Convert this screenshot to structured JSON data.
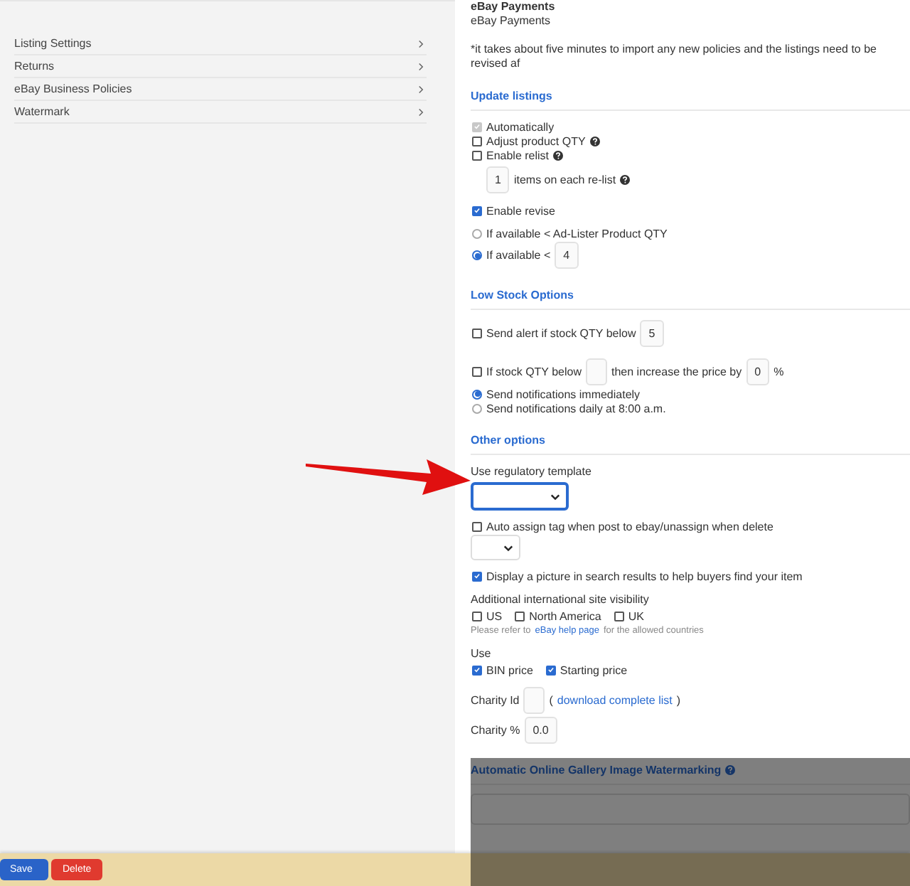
{
  "sidebar": {
    "items": [
      {
        "label": "Listing Settings"
      },
      {
        "label": "Returns"
      },
      {
        "label": "eBay Business Policies"
      },
      {
        "label": "Watermark"
      }
    ]
  },
  "payments": {
    "heading": "eBay Payments",
    "value": "eBay Payments",
    "note": "*it takes about five minutes to import any new policies and the listings need to be revised af"
  },
  "sections": [
    {
      "title": "Update listings",
      "help": false,
      "groups": [
        [
          {
            "kind": "line",
            "parts": [
              {
                "kind": "checkbox",
                "checked": true,
                "disabled": true
              },
              {
                "kind": "text",
                "text": "Automatically"
              }
            ]
          },
          {
            "kind": "line",
            "parts": [
              {
                "kind": "checkbox",
                "checked": false,
                "disabled": false
              },
              {
                "kind": "text",
                "text": "Adjust product QTY"
              },
              {
                "kind": "help"
              }
            ]
          },
          {
            "kind": "line",
            "parts": [
              {
                "kind": "checkbox",
                "checked": false,
                "disabled": false
              },
              {
                "kind": "text",
                "text": "Enable relist"
              },
              {
                "kind": "help"
              }
            ]
          },
          {
            "kind": "indented",
            "parts": [
              {
                "kind": "field",
                "value": "1"
              },
              {
                "kind": "text",
                "text": "items on each re-list"
              },
              {
                "kind": "help"
              }
            ]
          }
        ],
        [
          {
            "kind": "line",
            "parts": [
              {
                "kind": "checkbox",
                "checked": true,
                "disabled": false
              },
              {
                "kind": "text",
                "text": "Enable revise"
              }
            ]
          }
        ],
        [
          {
            "kind": "line",
            "parts": [
              {
                "kind": "radio",
                "selected": false
              },
              {
                "kind": "text",
                "text": "If available < Ad-Lister Product QTY"
              }
            ]
          },
          {
            "kind": "line",
            "parts": [
              {
                "kind": "radio",
                "selected": true
              },
              {
                "kind": "text",
                "text": "If available <"
              },
              {
                "kind": "field",
                "value": "4"
              }
            ]
          }
        ]
      ]
    },
    {
      "title": "Low Stock Options",
      "help": false,
      "groups": [
        [
          {
            "kind": "line",
            "parts": [
              {
                "kind": "checkbox",
                "checked": false,
                "disabled": false
              },
              {
                "kind": "text",
                "text": "Send alert if stock QTY below"
              },
              {
                "kind": "field",
                "value": "5"
              }
            ]
          }
        ],
        [
          {
            "kind": "line",
            "parts": [
              {
                "kind": "checkbox",
                "checked": false,
                "disabled": false
              },
              {
                "kind": "text",
                "text": "If stock QTY below"
              },
              {
                "kind": "field"
              },
              {
                "kind": "text",
                "text": "then increase the price by"
              },
              {
                "kind": "field",
                "value": "0"
              },
              {
                "kind": "text",
                "text": "%"
              }
            ]
          },
          {
            "kind": "line",
            "parts": [
              {
                "kind": "radio",
                "selected": true
              },
              {
                "kind": "text",
                "text": "Send notifications immediately"
              }
            ]
          },
          {
            "kind": "line",
            "parts": [
              {
                "kind": "radio",
                "selected": false
              },
              {
                "kind": "text",
                "text": "Send notifications daily at 8:00 a.m."
              }
            ]
          }
        ]
      ]
    },
    {
      "title": "Other options",
      "help": false,
      "groups": [
        [
          {
            "kind": "label",
            "parts": [
              {
                "kind": "text",
                "text": "Use regulatory template"
              }
            ]
          },
          {
            "kind": "line",
            "parts": [
              {
                "kind": "select",
                "focused": true
              }
            ]
          }
        ],
        [
          {
            "kind": "line",
            "parts": [
              {
                "kind": "checkbox",
                "checked": false,
                "disabled": false
              },
              {
                "kind": "text",
                "text": "Auto assign tag when post to ebay/unassign when delete"
              }
            ]
          },
          {
            "kind": "line",
            "parts": [
              {
                "kind": "select",
                "focused": false
              }
            ]
          }
        ],
        [
          {
            "kind": "line",
            "parts": [
              {
                "kind": "checkbox",
                "checked": true,
                "disabled": false
              },
              {
                "kind": "text",
                "text": "Display a picture in search results to help buyers find your item"
              }
            ]
          }
        ],
        [
          {
            "kind": "label",
            "parts": [
              {
                "kind": "text",
                "text": "Additional international site visibility"
              }
            ]
          },
          {
            "kind": "line",
            "parts": [
              {
                "kind": "checkbox",
                "checked": false,
                "disabled": false
              },
              {
                "kind": "text",
                "text": "US"
              },
              {
                "kind": "checkbox",
                "checked": false,
                "disabled": false
              },
              {
                "kind": "text",
                "text": "North America"
              },
              {
                "kind": "checkbox",
                "checked": false,
                "disabled": false
              },
              {
                "kind": "text",
                "text": "UK"
              }
            ]
          },
          {
            "kind": "note",
            "parts": [
              {
                "kind": "text",
                "text": "Please refer to"
              },
              {
                "kind": "link",
                "text": "eBay help page"
              },
              {
                "kind": "text",
                "text": "for the allowed countries"
              }
            ]
          }
        ],
        [
          {
            "kind": "label",
            "parts": [
              {
                "kind": "text",
                "text": "Use"
              }
            ]
          },
          {
            "kind": "line",
            "parts": [
              {
                "kind": "checkbox",
                "checked": true,
                "disabled": false
              },
              {
                "kind": "text",
                "text": "BIN price"
              },
              {
                "kind": "checkbox",
                "checked": true,
                "disabled": false
              },
              {
                "kind": "text",
                "text": "Starting price"
              }
            ]
          }
        ],
        [
          {
            "kind": "line",
            "parts": [
              {
                "kind": "text",
                "text": "Charity Id"
              },
              {
                "kind": "field"
              },
              {
                "kind": "text",
                "text": "("
              },
              {
                "kind": "link",
                "text": "download complete list"
              },
              {
                "kind": "text",
                "text": ")"
              }
            ]
          },
          {
            "kind": "line",
            "parts": [
              {
                "kind": "text",
                "text": "Charity %"
              },
              {
                "kind": "field",
                "value": "0.0"
              }
            ]
          }
        ]
      ]
    },
    {
      "title": "Automatic Online Gallery Image Watermarking",
      "help": true,
      "groups": [
        [
          {
            "kind": "box"
          }
        ]
      ]
    }
  ],
  "buttons": [
    {
      "label": "Save",
      "kind": "primary"
    },
    {
      "label": "Delete",
      "kind": "danger"
    }
  ]
}
